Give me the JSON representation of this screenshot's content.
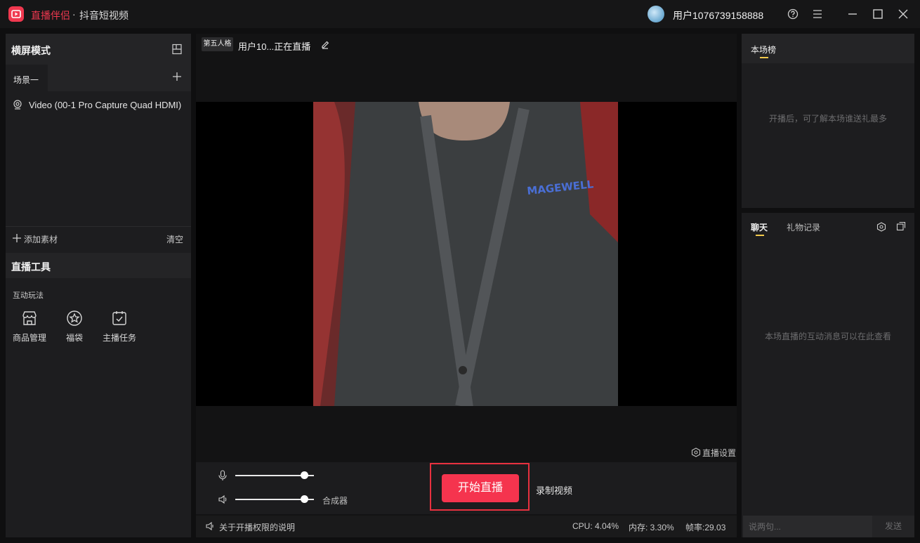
{
  "titlebar": {
    "app_name": "直播伴侣",
    "separator": "·",
    "platform": "抖音短视频",
    "username": "用户1076739158888"
  },
  "left": {
    "mode_title": "横屏模式",
    "scene_tab": "场景一",
    "source": "Video (00-1 Pro Capture Quad HDMI)",
    "add_material": "添加素材",
    "clear": "清空",
    "tools_title": "直播工具",
    "interact_label": "互动玩法",
    "tools": [
      {
        "label": "商品管理",
        "icon": "store-icon"
      },
      {
        "label": "福袋",
        "icon": "star-bag-icon"
      },
      {
        "label": "主播任务",
        "icon": "task-check-icon"
      }
    ]
  },
  "center": {
    "tag": "第五人格",
    "stream_title": "用户10...正在直播",
    "camera_text": "MAGEWELL",
    "live_settings": "直播设置",
    "mic_level": 0.82,
    "speaker_level": 0.82,
    "mixer": "合成器",
    "start_button": "开始直播",
    "record": "录制视频",
    "notice": "关于开播权限的说明",
    "cpu": "CPU: 4.04%",
    "memory": "内存: 3.30%",
    "fps": "帧率:29.03"
  },
  "right": {
    "rank_title": "本场榜",
    "rank_empty": "开播后，可了解本场谁送礼最多",
    "chat_tab": "聊天",
    "gift_tab": "礼物记录",
    "chat_empty": "本场直播的互动消息可以在此查看",
    "chat_placeholder": "说两句...",
    "send": "发送"
  },
  "colors": {
    "accent": "#f5344e",
    "tab_underline": "#f2c94c",
    "background": "#0f0f10"
  }
}
